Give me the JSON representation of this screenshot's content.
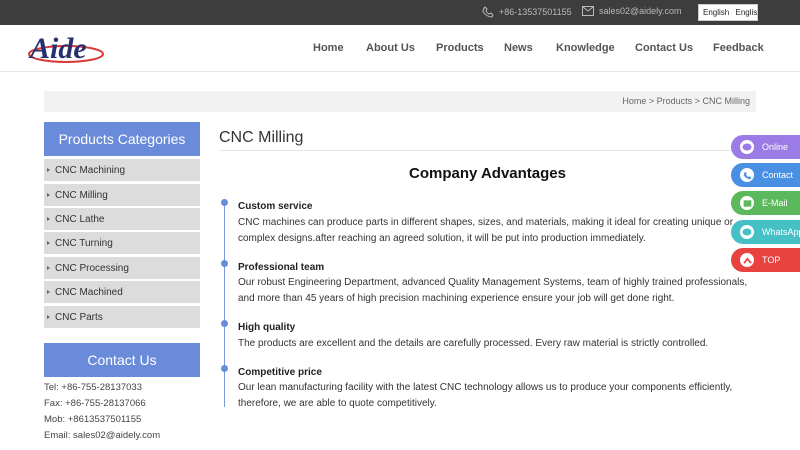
{
  "topbar": {
    "phone": "+86-13537501155",
    "email": "sales02@aidely.com",
    "language_label": "English",
    "language_select": "English"
  },
  "header": {
    "logo_text": "Aide",
    "nav": [
      "Home",
      "About Us",
      "Products",
      "News",
      "Knowledge",
      "Contact Us",
      "Feedback"
    ]
  },
  "breadcrumb": {
    "home": "Home",
    "sep1": ">",
    "products": "Products",
    "sep2": ">",
    "current": "CNC Milling"
  },
  "sidebar": {
    "categories_title": "Products Categories",
    "categories": [
      "CNC Machining",
      "CNC Milling",
      "CNC Lathe",
      "CNC Turning",
      "CNC Processing",
      "CNC Machined",
      "CNC Parts"
    ],
    "contact_title": "Contact Us",
    "contact_lines": [
      "Tel: +86-755-28137033",
      "Fax: +86-755-28137066",
      "Mob: +8613537501155",
      "Email: sales02@aidely.com"
    ]
  },
  "main": {
    "page_title": "CNC Milling",
    "section_title": "Company Advantages",
    "advantages": [
      {
        "title": "Custom service",
        "text": "CNC machines can produce parts in different shapes, sizes, and materials, making it ideal for creating unique or complex designs.after reaching an agreed solution, it will be put into production immediately."
      },
      {
        "title": "Professional team",
        "text": "Our robust Engineering Department, advanced Quality Management Systems, team of highly trained professionals, and more than 45 years of high precision machining experience ensure your job will get done right."
      },
      {
        "title": "High quality",
        "text": "The products are excellent and the details are carefully processed. Every raw material is strictly controlled."
      },
      {
        "title": "Competitive price",
        "text": "Our lean manufacturing facility with the latest CNC technology allows us to produce your components efficiently, therefore, we are able to quote competitively."
      }
    ]
  },
  "floating": [
    {
      "label": "Online",
      "color": "#9b7be6",
      "icon": "chat-icon"
    },
    {
      "label": "Contact",
      "color": "#4a90e2",
      "icon": "phone-icon"
    },
    {
      "label": "E-Mail",
      "color": "#5cb85c",
      "icon": "mail-icon"
    },
    {
      "label": "WhatsApp",
      "color": "#45c1c5",
      "icon": "whatsapp-icon"
    },
    {
      "label": "TOP",
      "color": "#e8423f",
      "icon": "arrow-up-icon"
    }
  ],
  "colors": {
    "accent": "#6a8bd9",
    "topbar": "#3d3d3d"
  }
}
